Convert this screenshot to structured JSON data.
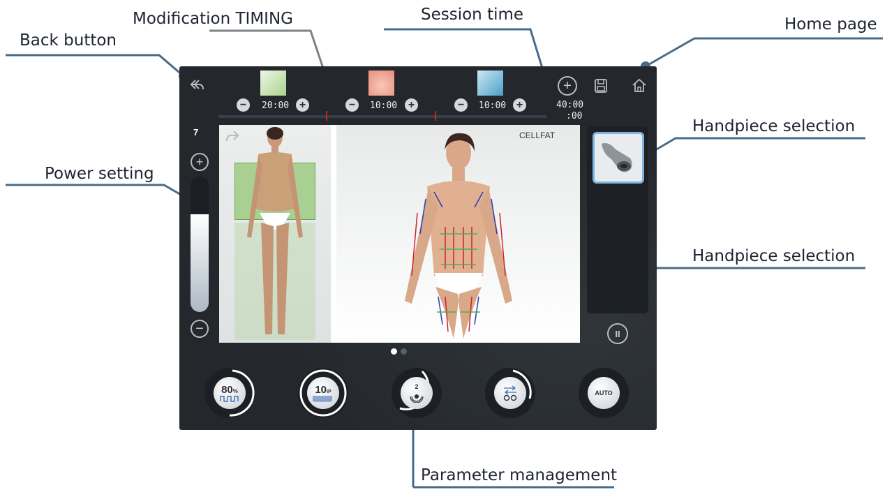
{
  "callouts": {
    "back_button": "Back button",
    "modification_timing": "Modification TIMING",
    "session_time": "Session time",
    "home_page": "Home page",
    "handpiece_selection_top": "Handpiece selection",
    "power_setting": "Power setting",
    "handpiece_selection_mid": "Handpiece selection",
    "parameter_management": "Parameter management"
  },
  "device": {
    "timers": [
      "20:00",
      "10:00",
      "10:00"
    ],
    "session_time_top": "40:00",
    "session_time_bottom": ":00",
    "power_level": "7",
    "power_fill_fraction": 0.72,
    "program_label": "CELLFAT",
    "page_indicator": {
      "pages": 2,
      "active": 0
    },
    "params": [
      {
        "value": "80",
        "unit": "%",
        "icon": "pulse-wave-icon"
      },
      {
        "value": "10",
        "unit": "IP",
        "icon": "pulse-train-icon"
      },
      {
        "value": "2",
        "unit": "",
        "icon": "vacuum-icon"
      },
      {
        "value": "",
        "unit": "",
        "icon": "direction-arrows-icon"
      },
      {
        "value": "AUTO",
        "unit": "",
        "icon": ""
      }
    ],
    "icons": [
      "back-arrow-icon",
      "plus-circle-icon",
      "save-icon",
      "home-icon",
      "redo-arrow-icon",
      "pause-icon"
    ],
    "colors": {
      "panel": "#24282d",
      "callout_line": "#4a6b88",
      "accent_red": "#d0202a",
      "zone_green": "#8dc56c"
    }
  }
}
